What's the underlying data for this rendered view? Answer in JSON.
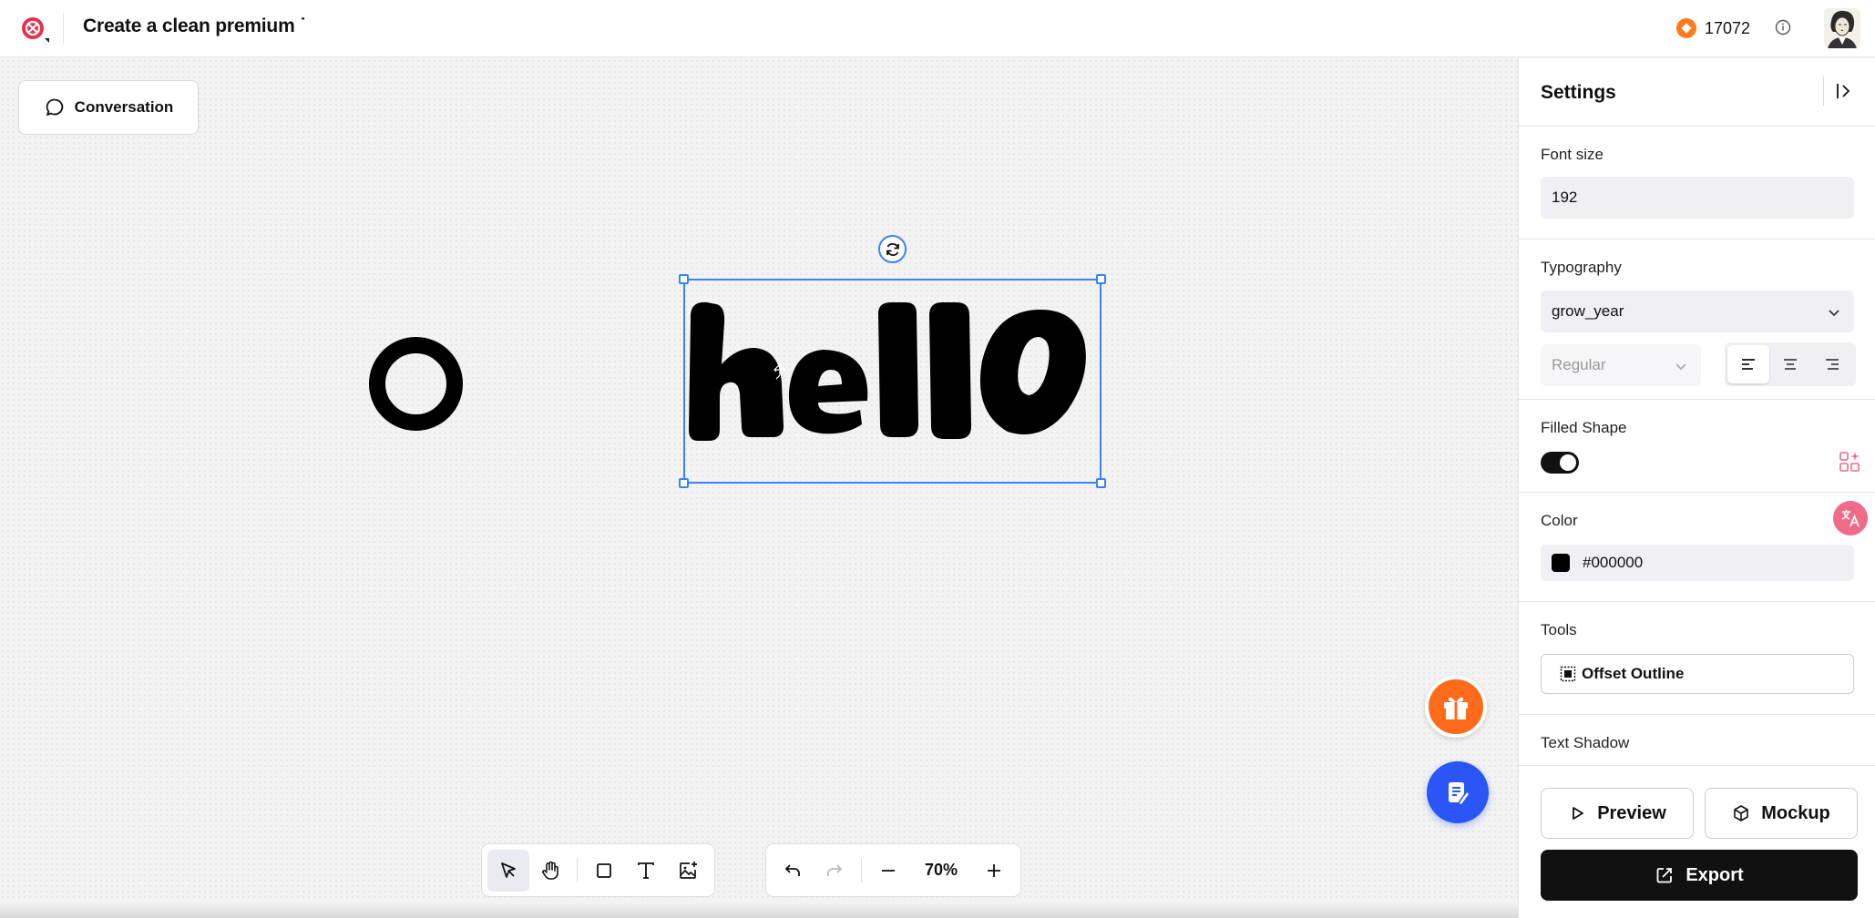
{
  "header": {
    "doc_title": "Create a clean premium ˙",
    "credits": "17072"
  },
  "canvas": {
    "conversation_label": "Conversation",
    "text_content": "hello",
    "zoom": "70%"
  },
  "settings": {
    "title": "Settings",
    "font_size_label": "Font size",
    "font_size_value": "192",
    "typography_label": "Typography",
    "font_family": "grow_year",
    "font_weight": "Regular",
    "filled_shape_label": "Filled Shape",
    "filled_shape_on": true,
    "color_label": "Color",
    "color_value": "#000000",
    "tools_label": "Tools",
    "offset_outline_label": "Offset Outline",
    "text_shadow_label": "Text Shadow",
    "preview_label": "Preview",
    "mockup_label": "Mockup",
    "export_label": "Export"
  },
  "colors": {
    "accent_blue": "#3b82f6",
    "gift_orange": "#ff6b1a",
    "notes_blue": "#2a56f5",
    "export_bg": "#111111"
  },
  "icons": [
    "logo-icon",
    "coin-icon",
    "info-icon",
    "chat-bubble-icon",
    "rotate-icon",
    "gift-icon",
    "edit-note-icon",
    "pointer-icon",
    "hand-icon",
    "square-icon",
    "text-icon",
    "image-add-icon",
    "undo-icon",
    "redo-icon",
    "minus-icon",
    "plus-icon",
    "collapse-panel-icon",
    "chevron-down-icon",
    "align-left-icon",
    "align-center-icon",
    "align-right-icon",
    "shapes-sparkle-icon",
    "translate-icon",
    "outline-icon",
    "play-icon",
    "cube-icon",
    "export-icon"
  ]
}
